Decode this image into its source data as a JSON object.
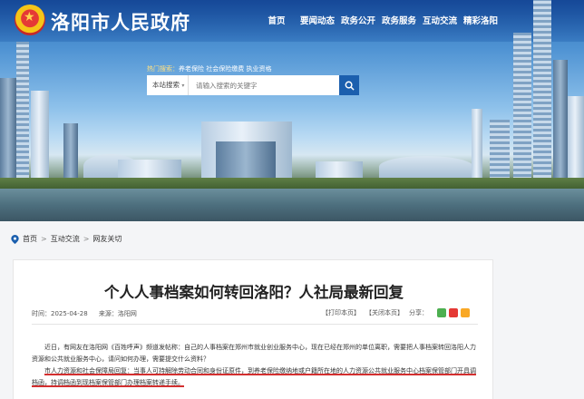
{
  "header": {
    "site_title": "洛阳市人民政府",
    "nav": [
      "首页",
      "要闻动态",
      "政务公开",
      "政务服务",
      "互动交流",
      "精彩洛阳"
    ]
  },
  "search": {
    "hot_label": "热门搜索：",
    "hot_terms": "养老保险 社会保险缴费 执业资格",
    "scope": "本站搜索",
    "placeholder": "请输入搜索的关键字"
  },
  "breadcrumb": [
    "首页",
    "互动交流",
    "网友关切"
  ],
  "article": {
    "title": "个人人事档案如何转回洛阳？人社局最新回复",
    "time": "时间：2025-04-28",
    "source": "来源：洛阳网",
    "print": "【打印本页】",
    "close": "【关闭本页】",
    "share_label": "分享：",
    "paragraphs": [
      "近日，有网友在洛阳网《百姓呼声》频道发帖称：自己的人事档案在郑州市就业创业服务中心，现在已经在郑州的单位离职，需要把人事档案转回洛阳人力资源和公共就业服务中心，请问如何办理，需要提交什么资料？",
      "市人力资源和社会保障局回复：当事人可持解除劳动合同和身份证原件，到养老保险缴纳地或户籍所在地的人力资源公共就业服务中心档案保管部门开具调档函，持调档函到现档案保管部门办理档案转递手续。"
    ]
  },
  "colors": {
    "nav_blue": "#1b5fae",
    "underline_red": "#d32f2f",
    "share_wechat": "#4caf50",
    "share_weibo": "#e53935",
    "share_qzone": "#f9a825"
  }
}
